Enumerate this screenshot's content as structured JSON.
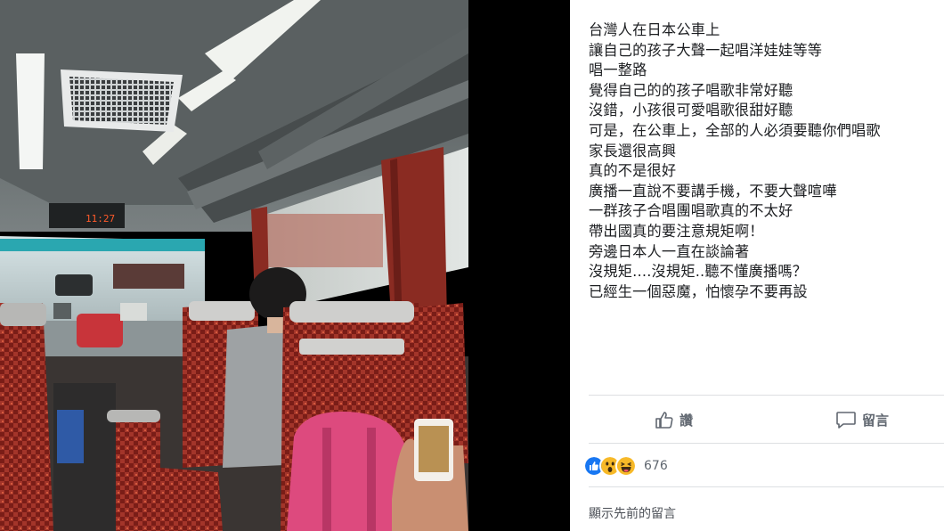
{
  "post": {
    "lines": [
      "台灣人在日本公車上",
      "讓自己的孩子大聲一起唱洋娃娃等等",
      "唱一整路",
      "覺得自己的的孩子唱歌非常好聽",
      "沒錯，小孩很可愛唱歌很甜好聽",
      "可是，在公車上，全部的人必須要聽你們唱歌",
      "家長還很高興",
      "真的不是很好",
      "廣播一直說不要講手機，不要大聲喧嘩",
      "一群孩子合唱團唱歌真的不太好",
      "帶出國真的要注意規矩啊！",
      "旁邊日本人一直在談論著",
      "沒規矩....沒規矩..聽不懂廣播嗎？",
      "已經生一個惡魔，怕懷孕不要再設"
    ]
  },
  "photo": {
    "clock": "11:27"
  },
  "actions": {
    "like_label": "讚",
    "comment_label": "留言"
  },
  "reactions": {
    "icons": [
      "like-icon",
      "wow-icon",
      "haha-icon"
    ],
    "count": "676"
  },
  "comments": {
    "show_previous": "顯示先前的留言"
  },
  "colors": {
    "like_blue": "#1877f2",
    "reaction_yellow": "#f7b928",
    "text": "#1c1e21",
    "secondary": "#606770",
    "divider": "#dddfe2"
  }
}
